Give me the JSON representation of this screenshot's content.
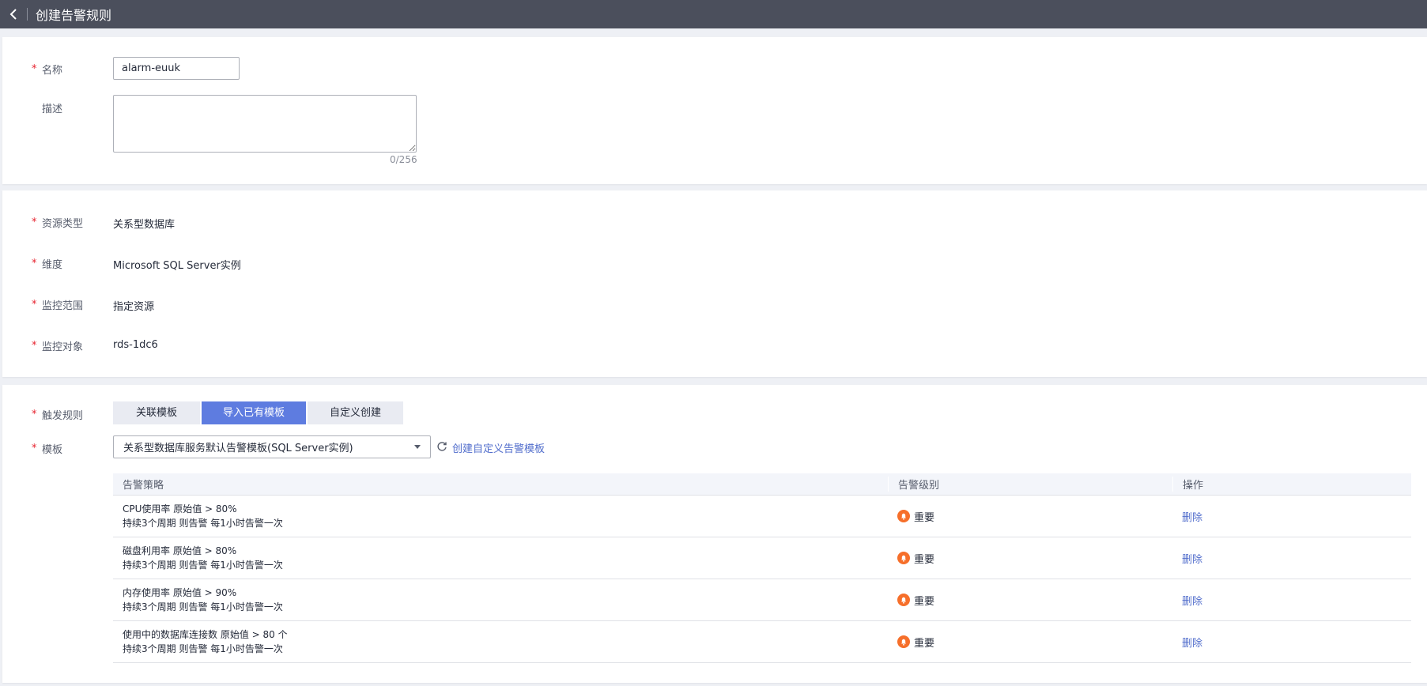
{
  "header": {
    "title": "创建告警规则"
  },
  "basic": {
    "name_label": "名称",
    "name_value": "alarm-euuk",
    "desc_label": "描述",
    "desc_counter": "0/256"
  },
  "resource": {
    "rows": [
      {
        "label": "资源类型",
        "value": "关系型数据库"
      },
      {
        "label": "维度",
        "value": "Microsoft SQL Server实例"
      },
      {
        "label": "监控范围",
        "value": "指定资源"
      },
      {
        "label": "监控对象",
        "value": "rds-1dc6"
      }
    ]
  },
  "trigger": {
    "label": "触发规则",
    "tabs": [
      {
        "label": "关联模板",
        "active": false
      },
      {
        "label": "导入已有模板",
        "active": true
      },
      {
        "label": "自定义创建",
        "active": false
      }
    ],
    "template_label": "模板",
    "template_value": "关系型数据库服务默认告警模板(SQL Server实例)",
    "create_link": "创建自定义告警模板",
    "table": {
      "headers": [
        "告警策略",
        "告警级别",
        "操作"
      ],
      "rows": [
        {
          "line1": "CPU使用率 原始值 > 80%",
          "line2": "持续3个周期 则告警 每1小时告警一次",
          "level": "重要",
          "action": "删除"
        },
        {
          "line1": "磁盘利用率 原始值 > 80%",
          "line2": "持续3个周期 则告警 每1小时告警一次",
          "level": "重要",
          "action": "删除"
        },
        {
          "line1": "内存使用率 原始值 > 90%",
          "line2": "持续3个周期 则告警 每1小时告警一次",
          "level": "重要",
          "action": "删除"
        },
        {
          "line1": "使用中的数据库连接数 原始值 > 80 个",
          "line2": "持续3个周期 则告警 每1小时告警一次",
          "level": "重要",
          "action": "删除"
        }
      ]
    }
  },
  "colors": {
    "topbar": "#4b4f5c",
    "accent": "#5e7ce0",
    "link": "#526ecc",
    "required": "#e7222e",
    "level_major": "#f66f2a"
  }
}
